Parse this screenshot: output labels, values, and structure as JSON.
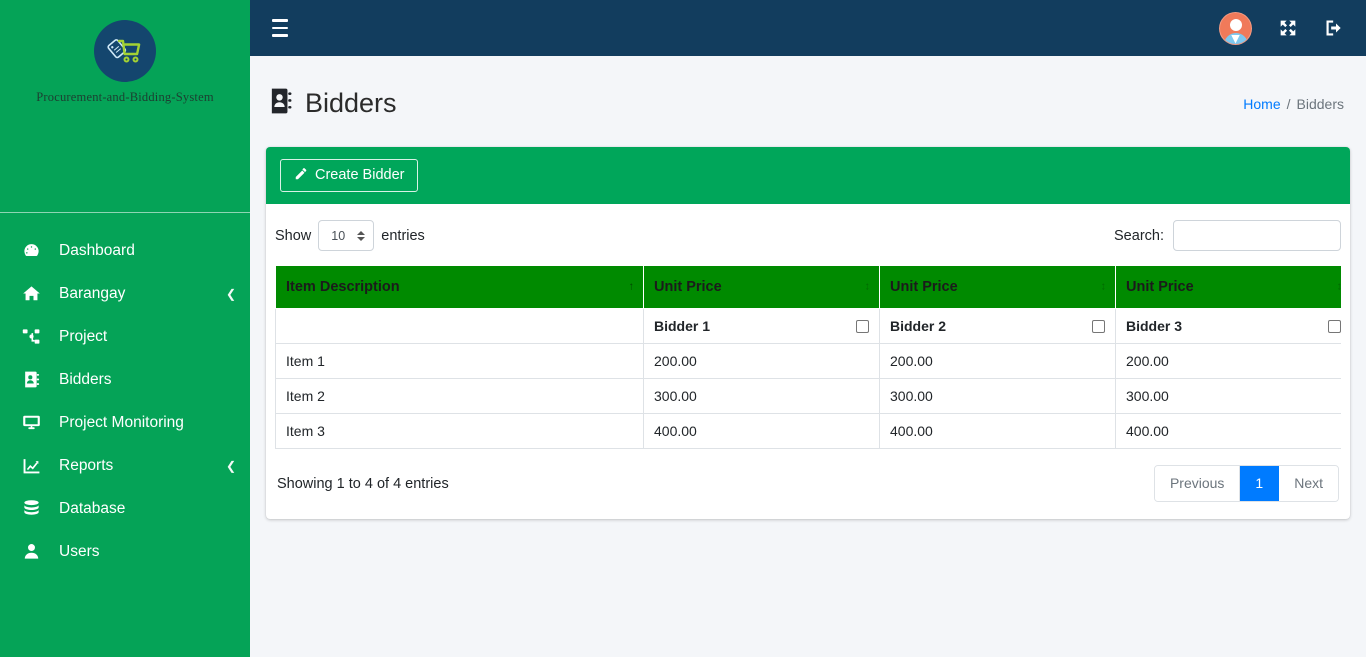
{
  "brand": {
    "name": "Procurement-and-Bidding-System",
    "logo_icon": "shopping-cart-tag-logo"
  },
  "sidebar": {
    "items": [
      {
        "label": "Dashboard",
        "icon": "tachometer-icon",
        "arrow": ""
      },
      {
        "label": "Barangay",
        "icon": "home-icon",
        "arrow": "❮"
      },
      {
        "label": "Project",
        "icon": "sitemap-icon",
        "arrow": ""
      },
      {
        "label": "Bidders",
        "icon": "address-book-icon",
        "arrow": ""
      },
      {
        "label": "Project Monitoring",
        "icon": "desktop-icon",
        "arrow": ""
      },
      {
        "label": "Reports",
        "icon": "chart-line-icon",
        "arrow": "❮"
      },
      {
        "label": "Database",
        "icon": "database-icon",
        "arrow": ""
      },
      {
        "label": "Users",
        "icon": "user-icon",
        "arrow": ""
      }
    ]
  },
  "topbar": {
    "menu_icon": "hamburger-icon",
    "avatar_icon": "user-avatar",
    "fullscreen_icon": "expand-arrows-icon",
    "logout_icon": "sign-out-icon"
  },
  "page": {
    "title": "Bidders",
    "title_icon": "address-book-icon",
    "breadcrumb": {
      "home": "Home",
      "separator": "/",
      "current": "Bidders"
    }
  },
  "card": {
    "create_button": "Create Bidder",
    "create_button_icon": "pencil-icon"
  },
  "datatable": {
    "show_label": "Show",
    "entries_label": "entries",
    "page_length": "10",
    "search_label": "Search:",
    "search_value": "",
    "search_placeholder": "",
    "columns": [
      {
        "label": "Item Description",
        "sort": "↑",
        "sorted": true
      },
      {
        "label": "Unit Price",
        "sort": "↕",
        "sorted": false
      },
      {
        "label": "Unit Price",
        "sort": "↕",
        "sorted": false
      },
      {
        "label": "Unit Price",
        "sort": "↕",
        "sorted": false
      }
    ],
    "bidder_row": {
      "description": "",
      "bidders": [
        "Bidder 1",
        "Bidder 2",
        "Bidder 3"
      ]
    },
    "rows": [
      {
        "description": "Item 1",
        "prices": [
          "200.00",
          "200.00",
          "200.00"
        ]
      },
      {
        "description": "Item 2",
        "prices": [
          "300.00",
          "300.00",
          "300.00"
        ]
      },
      {
        "description": "Item 3",
        "prices": [
          "400.00",
          "400.00",
          "400.00"
        ]
      }
    ],
    "info": "Showing 1 to 4 of 4 entries",
    "pagination": {
      "previous": "Previous",
      "page_1": "1",
      "next": "Next"
    }
  },
  "colors": {
    "sidebar_green": "#05a357",
    "card_header_green": "#00a65a",
    "table_header_green": "#008a00",
    "topbar_navy": "#123d5e",
    "accent_blue": "#007bff",
    "content_bg": "#f4f6f9"
  }
}
